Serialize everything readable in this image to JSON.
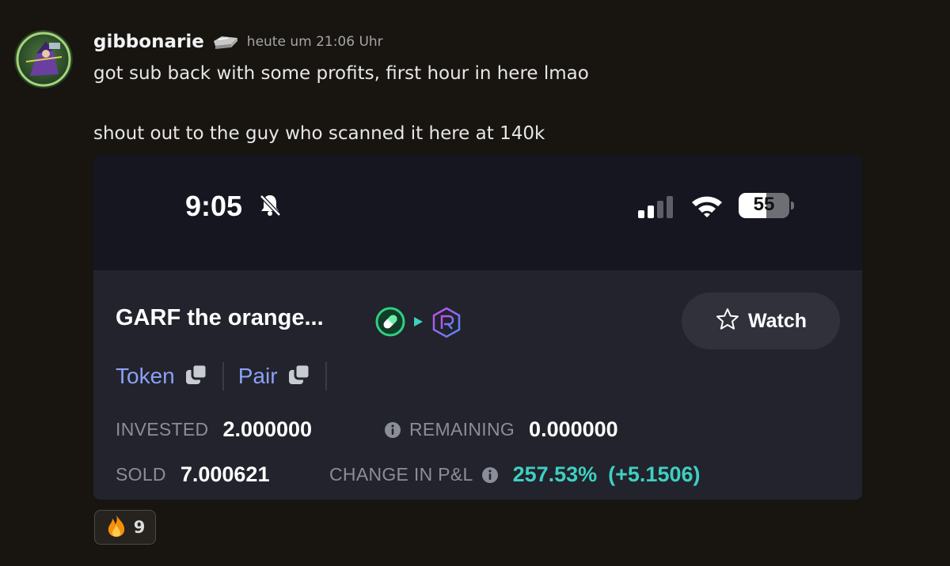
{
  "message": {
    "username": "gibbonarie",
    "timestamp": "heute um 21:06 Uhr",
    "lines": [
      "got sub back with some profits, first hour in here lmao",
      "shout out to the guy who scanned it here at 140k"
    ]
  },
  "screenshot": {
    "status_bar": {
      "time": "9:05",
      "battery": "55",
      "icons": [
        "bell-slash-icon",
        "signal-icon",
        "wifi-icon",
        "battery-icon"
      ]
    },
    "token": {
      "name": "GARF the orange...",
      "badges": [
        "pill-icon",
        "play-icon",
        "raydium-icon"
      ]
    },
    "watch_button": {
      "label": "Watch",
      "icon": "star-outline-icon"
    },
    "links": [
      {
        "label": "Token",
        "icon": "copy-icon"
      },
      {
        "label": "Pair",
        "icon": "copy-icon"
      }
    ],
    "stats": {
      "invested_label": "INVESTED",
      "invested_value": "2.000000",
      "remaining_label": "REMAINING",
      "remaining_value": "0.000000",
      "sold_label": "SOLD",
      "sold_value": "7.000621",
      "pnl_label": "CHANGE IN P&L",
      "pnl_percent": "257.53%",
      "pnl_delta": "(+5.1506)"
    }
  },
  "reaction": {
    "emoji": "fire-icon",
    "count": "9"
  },
  "colors": {
    "background": "#18140f",
    "card": "#22232c",
    "status_bar": "#151620",
    "link": "#8aa1f5",
    "profit": "#3ed0c2",
    "label": "#8b8d98"
  }
}
